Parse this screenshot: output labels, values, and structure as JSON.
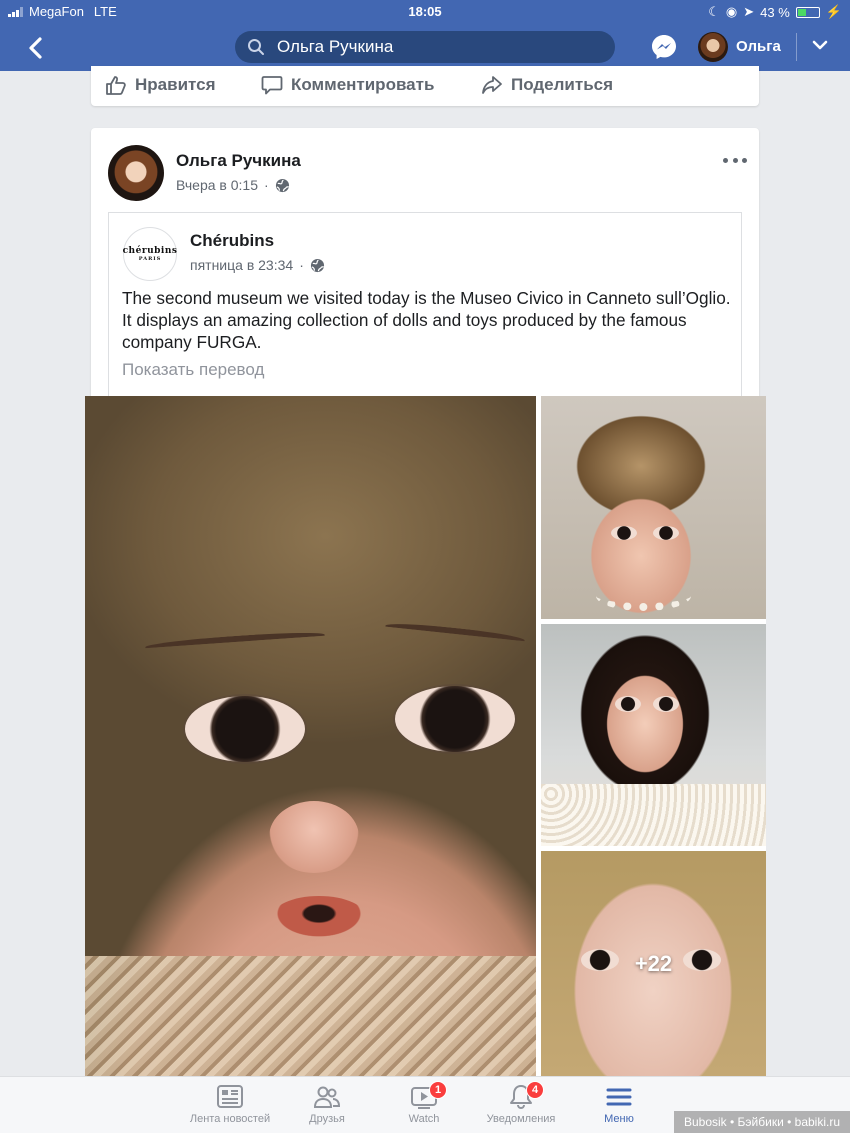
{
  "status_bar": {
    "carrier": "MegaFon",
    "network": "LTE",
    "time": "18:05",
    "battery": "43 %",
    "battery_level": 0.43
  },
  "nav": {
    "search_value": "Ольга Ручкина",
    "user_name": "Ольга"
  },
  "prev_actions": {
    "like": "Нравится",
    "comment": "Комментировать",
    "share": "Поделиться"
  },
  "post": {
    "author": "Ольга Ручкина",
    "timestamp": "Вчера в 0:15",
    "shared": {
      "page_name": "Chérubins",
      "logo_text": "chérubins",
      "logo_sub": "PARIS",
      "timestamp": "пятница в 23:34",
      "text": "The second museum we visited today is the Museo Civico in Canneto sull’Oglio. It displays an amazing collection of dolls and toys produced by the famous company FURGA.",
      "translate_label": "Показать перевод"
    },
    "more_photos": "+22"
  },
  "tabs": [
    {
      "label": "Лента новостей",
      "icon": "news-feed-icon"
    },
    {
      "label": "Друзья",
      "icon": "friends-icon"
    },
    {
      "label": "Watch",
      "icon": "watch-icon",
      "badge": "1"
    },
    {
      "label": "Уведомления",
      "icon": "bell-icon",
      "badge": "4"
    },
    {
      "label": "Меню",
      "icon": "menu-icon",
      "active": true
    }
  ],
  "watermark": "Bubosik • Бэйбики • babiki.ru",
  "colors": {
    "brand": "#4267b2",
    "badge": "#fa3e3e",
    "secondary_text": "#606770"
  }
}
